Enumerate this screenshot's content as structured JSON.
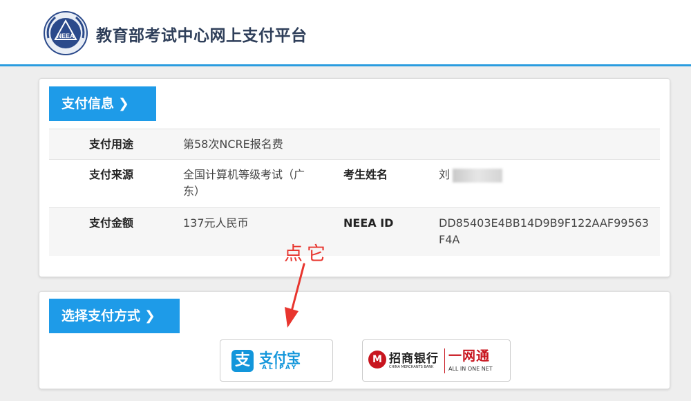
{
  "header": {
    "logo_text": "NEEA",
    "site_title": "教育部考试中心网上支付平台"
  },
  "payment_info": {
    "section_title": "支付信息",
    "chevron": "❯",
    "rows": [
      {
        "label": "支付用途",
        "value": "第58次NCRE报名费"
      },
      {
        "label": "支付来源",
        "value": "全国计算机等级考试（广东）",
        "label2": "考生姓名",
        "value2": "刘"
      },
      {
        "label": "支付金额",
        "value": "137元人民币",
        "label2": "NEEA ID",
        "value2": "DD85403E4BB14D9B9F122AAF99563F4A"
      }
    ]
  },
  "annotation": {
    "text": "点它",
    "color": "#e8352e"
  },
  "payment_method": {
    "section_title": "选择支付方式",
    "chevron": "❯",
    "alipay": {
      "mark": "支",
      "name": "支付宝",
      "sub": "ALIPAY",
      "color": "#1296db"
    },
    "cmb": {
      "logo": "M",
      "name": "招商银行",
      "name_en": "CHINA MERCHANTS BANK",
      "net": "一网通",
      "net_en": "ALL IN ONE NET",
      "color": "#c8151e"
    }
  },
  "colors": {
    "accent_blue": "#1e9be8",
    "header_border": "#2a9cdf"
  }
}
